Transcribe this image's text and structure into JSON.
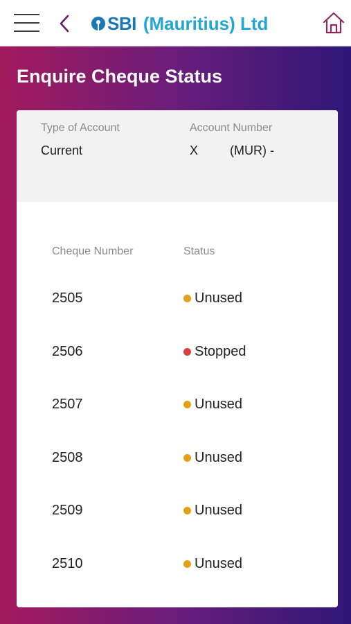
{
  "header": {
    "brand_sbi": "SBI",
    "brand_rest": "(Mauritius) Ltd",
    "colors": {
      "brand_dark": "#1a78b6",
      "brand_light": "#21a6d6",
      "home_icon": "#8e2a5a"
    },
    "icons": [
      "menu-icon",
      "back-chevron-icon",
      "sbi-logo-icon",
      "home-icon"
    ]
  },
  "page": {
    "title": "Enquire Cheque Status"
  },
  "account": {
    "type_label": "Type of Account",
    "type_value": "Current",
    "number_label": "Account Number",
    "number_value_prefix": "X",
    "number_value_suffix": "(MUR) -"
  },
  "cheques": {
    "col_number": "Cheque Number",
    "col_status": "Status",
    "status_colors": {
      "Unused": "#e5a01a",
      "Stopped": "#d9423c"
    },
    "rows": [
      {
        "number": "2505",
        "status": "Unused"
      },
      {
        "number": "2506",
        "status": "Stopped"
      },
      {
        "number": "2507",
        "status": "Unused"
      },
      {
        "number": "2508",
        "status": "Unused"
      },
      {
        "number": "2509",
        "status": "Unused"
      },
      {
        "number": "2510",
        "status": "Unused"
      }
    ]
  }
}
